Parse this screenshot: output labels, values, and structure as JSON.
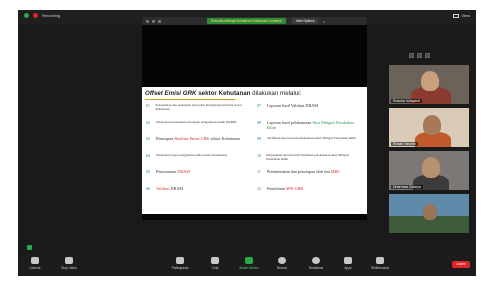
{
  "topbar": {
    "recording_label": "Recording",
    "view_label": "View",
    "rec_dot_color": "#2ba84a",
    "rec_dot2_color": "#e0242a"
  },
  "share_bar": {
    "title": "Pescaria sinkerja Kehutanan Kolaborasi Lumanoe",
    "view_options": "View Options",
    "close_icon": "×"
  },
  "slide": {
    "title_part1": "Offset Emisi GRK",
    "title_part2": " sektor Kehutanan",
    "title_part3": " dilakukan melalui:",
    "left_items": [
      {
        "num": "01",
        "text": "Penyusunan dan penetapan peta jalan Perdagangan Karbon sector Kehutanan"
      },
      {
        "num": "02",
        "text": "Penetapan persetujuan rancangan penggunaan untuk (DaRH)"
      },
      {
        "num": "03",
        "text_a": "Penetapan ",
        "text_hl": "Baseline Emisi GRK",
        "text_b": " sektor Kehutanan"
      },
      {
        "num": "04",
        "text": "Penetapan target penggunaan emisi sektor Kehutanan;"
      },
      {
        "num": "05",
        "text_a": "Penyusunan ",
        "text_hl": "DRAM",
        "text_b": ""
      },
      {
        "num": "06",
        "text_a": "",
        "text_hl": "Validasi",
        "text_b": " DRAM"
      }
    ],
    "right_items": [
      {
        "num": "07",
        "text_a": "Laporan hasil Validasi DRAM",
        "text_hl": "",
        "text_b": ""
      },
      {
        "num": "08",
        "text_a": "Laporan hasil pelaksanaan ",
        "text_hl": "Aksi Mitigasi Perubahan Iklim",
        "text_b": ""
      },
      {
        "num": "09",
        "text": "Verifikasi laporan hasil pelaksanaan Aksi Mitigasi Perubahan Iklim"
      },
      {
        "num": "10",
        "text": "Penyusunan laporan hasil Verifikasi pelaksanaan Aksi Mitigasi Perubahan Iklim"
      },
      {
        "num": "11",
        "text_a": "Pembentukan dan penetapan oleh tim ",
        "text_hl": "MRV",
        "text_b": ""
      },
      {
        "num": "12",
        "text_a": "Penerbitan ",
        "text_hl": "SPE-GRK",
        "text_b": ""
      }
    ]
  },
  "gallery": {
    "participants": [
      {
        "name": "Rosmia Indayanti"
      },
      {
        "name": "Rohan Yasmin"
      },
      {
        "name": "Dharmwa Zafarya"
      },
      {
        "name": ""
      }
    ]
  },
  "toolbar": {
    "unmute": "Unmute",
    "stop_video": "Stop Video",
    "participants": "Participants",
    "participant_count": "8",
    "chat": "Chat",
    "share_screen": "Share Screen",
    "record": "Record",
    "reactions": "Reactions",
    "apps": "Apps",
    "whiteboards": "Whiteboards",
    "leave": "Leave"
  }
}
